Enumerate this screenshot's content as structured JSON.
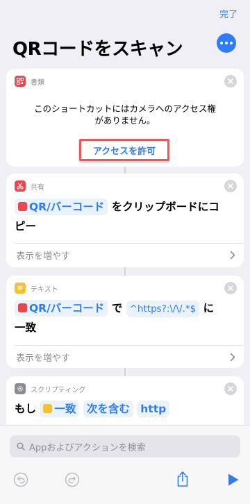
{
  "header": {
    "done_label": "完了",
    "title": "QRコードをスキャン"
  },
  "cards": {
    "documents": {
      "category": "書類",
      "message_line1": "このショートカットにはカメラへのアクセス権",
      "message_line2": "がありません。",
      "allow_label": "アクセスを許可"
    },
    "share": {
      "category": "共有",
      "token": "QR/バーコード",
      "text_line1": "をクリップボードにコ",
      "text_line2": "ピー",
      "more_label": "表示を増やす"
    },
    "text": {
      "category": "テキスト",
      "token": "QR/バーコード",
      "connector_word": "で",
      "pattern": "^https?:\\/\\/.*$",
      "particle": "に",
      "text_line2": "一致",
      "more_label": "表示を増やす"
    },
    "scripting": {
      "category": "スクリプティング",
      "if_word": "もし",
      "var_token": "一致",
      "condition": "次を含む",
      "value": "http"
    }
  },
  "bottom": {
    "search_placeholder": "Appおよびアクションを検索"
  },
  "colors": {
    "accent": "#2f7cf6",
    "red": "#e9464d",
    "yellow": "#f3c232",
    "highlight": "#e45b5f"
  }
}
